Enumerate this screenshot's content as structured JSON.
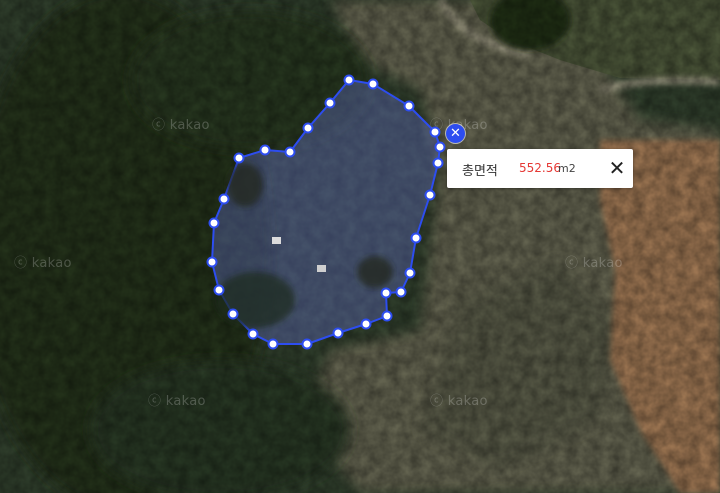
{
  "watermark_text": "ⓒ kakao",
  "measurement": {
    "label": "총면적",
    "value": "552.56",
    "unit": "m2",
    "close_symbol": "✕",
    "marker_symbol": "✕"
  },
  "colors": {
    "polygon_stroke": "#2d4df0",
    "polygon_fill": "rgba(110,120,220,0.35)",
    "vertex_fill": "#ffffff",
    "vertex_stroke": "#2d4df0",
    "value_color": "#e53935"
  }
}
